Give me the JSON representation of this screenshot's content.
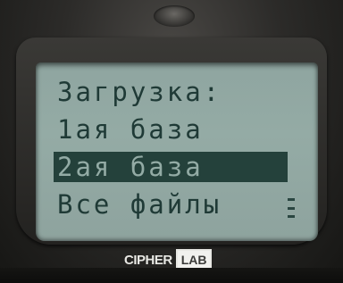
{
  "device": {
    "brand": "CIPHERLAB",
    "logo_cipher": "CIPHER",
    "logo_lab": "LAB"
  },
  "screen": {
    "title": "Загрузка:",
    "menu_items": [
      {
        "label": "1ая база",
        "selected": false
      },
      {
        "label": "2ая база",
        "selected": true
      },
      {
        "label": "Все файлы",
        "selected": false
      }
    ],
    "has_more_indicator": true
  },
  "colors": {
    "lcd_background": "#94aba5",
    "lcd_text": "#1f3a36",
    "selection_background": "#24413b",
    "device_body": "#2c2b29"
  }
}
